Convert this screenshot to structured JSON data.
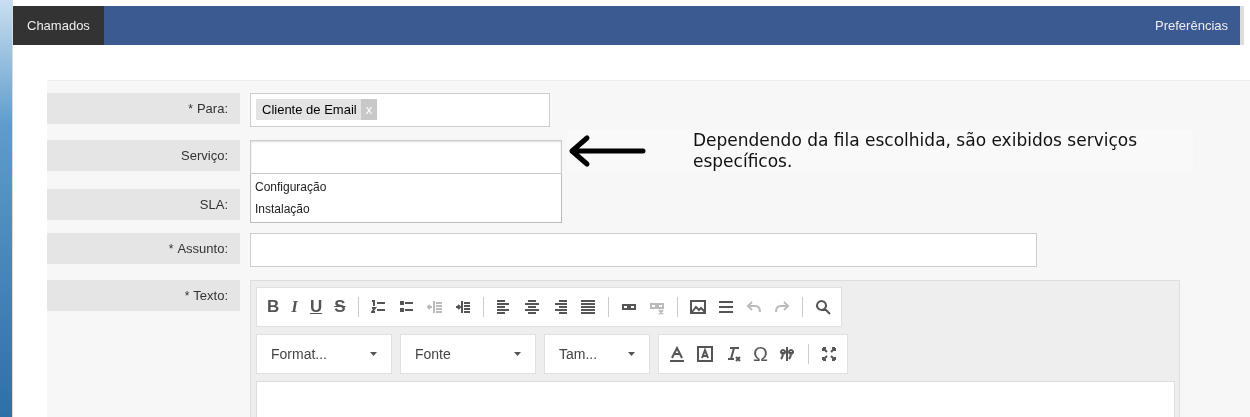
{
  "header": {
    "tabs": [
      {
        "label": "Chamados",
        "selected": true
      }
    ],
    "link": "Preferências"
  },
  "form": {
    "fields": [
      {
        "label": "Para:",
        "marker": "*",
        "kind": "tags",
        "tags": [
          {
            "text": "Cliente de Email",
            "remove": "x"
          }
        ]
      },
      {
        "label": "Serviço:",
        "kind": "select",
        "options": [
          {
            "text": "Configuração"
          },
          {
            "text": "Instalação"
          }
        ]
      },
      {
        "label": "SLA:",
        "kind": "hidden"
      },
      {
        "label": "Assunto:",
        "marker": "*",
        "kind": "text"
      },
      {
        "label": "Texto:",
        "marker": "*",
        "kind": "editor"
      }
    ]
  },
  "annotation": {
    "text": "Dependendo da fila escolhida, são exibidos serviços específicos."
  },
  "editor": {
    "toolbar1": [
      [
        {
          "kind": "bold",
          "text": "B",
          "disabled": false
        },
        {
          "kind": "italic",
          "text": "I",
          "disabled": false
        },
        {
          "kind": "underline",
          "text": "U",
          "disabled": false
        },
        {
          "kind": "strike",
          "text": "S",
          "disabled": false
        }
      ],
      [
        {
          "kind": "numbered-list",
          "disabled": false
        },
        {
          "kind": "bullet-list",
          "disabled": false
        },
        {
          "kind": "outdent",
          "disabled": true
        },
        {
          "kind": "indent",
          "disabled": false
        }
      ],
      [
        {
          "kind": "align-left",
          "disabled": false
        },
        {
          "kind": "align-center",
          "disabled": false
        },
        {
          "kind": "align-right",
          "disabled": false
        },
        {
          "kind": "justify",
          "disabled": false
        }
      ],
      [
        {
          "kind": "link",
          "disabled": false
        },
        {
          "kind": "unlink",
          "disabled": true
        }
      ],
      [
        {
          "kind": "image",
          "disabled": false
        },
        {
          "kind": "rule",
          "disabled": false
        },
        {
          "kind": "undo",
          "disabled": true
        },
        {
          "kind": "redo",
          "disabled": true
        }
      ],
      [
        {
          "kind": "search",
          "disabled": false
        }
      ]
    ],
    "combos": [
      {
        "label": "Format..."
      },
      {
        "label": "Fonte"
      },
      {
        "label": "Tam..."
      }
    ],
    "toolbar2": [
      [
        {
          "kind": "text-color",
          "disabled": false
        },
        {
          "kind": "background-color",
          "disabled": false
        },
        {
          "kind": "clear-format",
          "disabled": false
        },
        {
          "kind": "special-char",
          "text": "Ω",
          "disabled": false
        },
        {
          "kind": "bidi",
          "disabled": false
        }
      ],
      [
        {
          "kind": "maximize",
          "disabled": false
        }
      ]
    ]
  }
}
